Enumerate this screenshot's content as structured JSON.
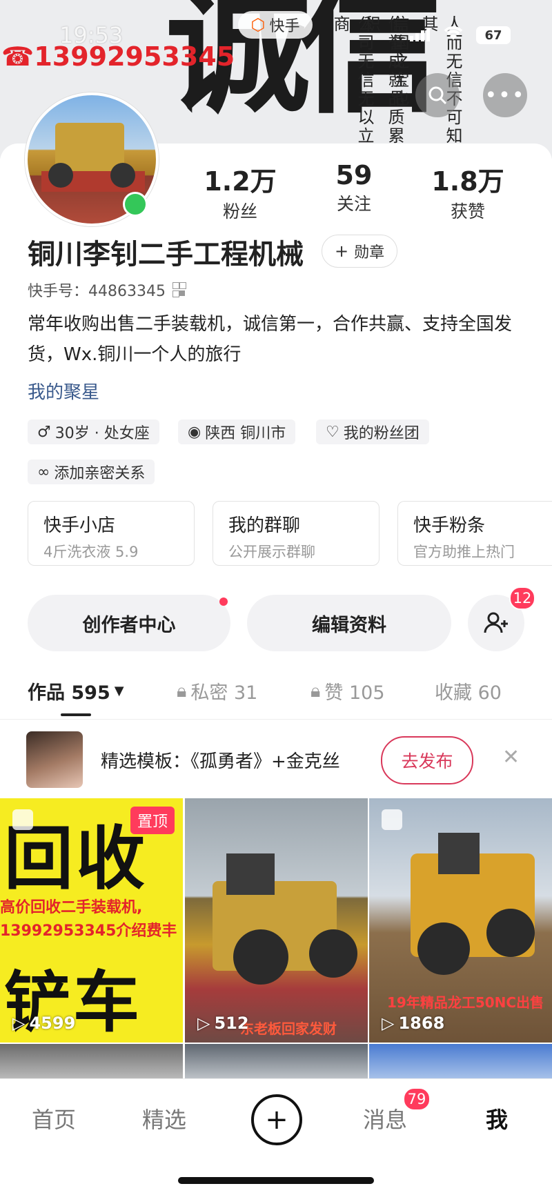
{
  "status": {
    "time": "19:53",
    "battery": "67"
  },
  "banner": {
    "phone": "☎13992953345",
    "app_logo": "快手",
    "calligraphy": "诚信",
    "verses": [
      "人而无信不可知其",
      "信国之宝也",
      "信誉成就品质累积",
      "公司无信无以立商"
    ]
  },
  "profile": {
    "stats": [
      {
        "num": "1.2万",
        "label": "粉丝"
      },
      {
        "num": "59",
        "label": "关注"
      },
      {
        "num": "1.8万",
        "label": "获赞"
      }
    ],
    "name": "铜川李钊二手工程机械",
    "medal_label": "勋章",
    "uid": "快手号：44863345",
    "bio": "常年收购出售二手装载机，诚信第一，合作共赢、支持全国发货，Wx.铜川一个人的旅行",
    "link": "我的聚星",
    "tags": [
      "30岁 · 处女座",
      "陕西 铜川市",
      "我的粉丝团",
      "添加亲密关系"
    ]
  },
  "services": [
    {
      "title": "快手小店",
      "sub": "4斤洗衣液 5.9"
    },
    {
      "title": "我的群聊",
      "sub": "公开展示群聊"
    },
    {
      "title": "快手粉条",
      "sub": "官方助推上热门"
    }
  ],
  "actions": {
    "creator": "创作者中心",
    "edit": "编辑资料",
    "friend_badge": "12"
  },
  "tabs": [
    {
      "label": "作品 595"
    },
    {
      "label": "私密 31"
    },
    {
      "label": "赞 105"
    },
    {
      "label": "收藏 60"
    }
  ],
  "template": {
    "text": "精选模板：《孤勇者》+金克丝",
    "button": "去发布"
  },
  "videos": [
    {
      "count": "4599",
      "pinned": "置顶",
      "big1": "回收",
      "big2": "铲车",
      "line1": "高价回收二手装载机,",
      "line2": "13992953345介绍费丰"
    },
    {
      "count": "512",
      "caption": "东老板回家发财"
    },
    {
      "count": "1868",
      "caption": "19年精品龙工50NC出售"
    }
  ],
  "nav": {
    "home": "首页",
    "featured": "精选",
    "messages": "消息",
    "me": "我",
    "msg_badge": "79"
  },
  "colors": {
    "accent": "#ff3b5c",
    "link": "#3a5a8c",
    "phone_red": "#e3242b"
  }
}
